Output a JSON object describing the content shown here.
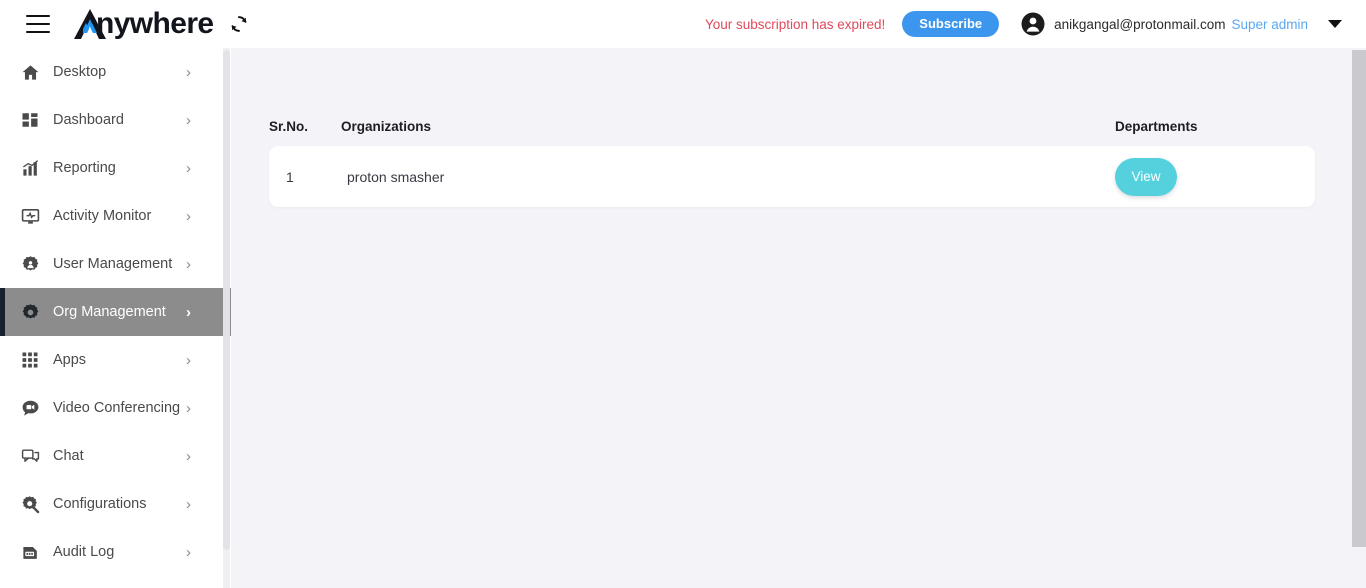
{
  "header": {
    "menu_icon": "hamburger-menu-icon",
    "brand_name": "nywhere",
    "brand_full": "Anywhere",
    "refresh_icon": "refresh-sync-icon",
    "subscription_notice": "Your subscription has expired!",
    "subscribe_label": "Subscribe",
    "avatar_icon": "user-avatar-icon",
    "user_email": "anikgangal@protonmail.com",
    "user_role": "Super admin",
    "dropdown_icon": "chevron-down-icon",
    "accent_blue": "#3d96ee",
    "role_blue": "#5aa8f0",
    "alert_red": "#e04a5b"
  },
  "sidebar": {
    "items": [
      {
        "label": "Desktop",
        "icon": "home-icon",
        "chevron": "›",
        "active": false
      },
      {
        "label": "Dashboard",
        "icon": "dashboard-grid-icon",
        "chevron": "›",
        "active": false
      },
      {
        "label": "Reporting",
        "icon": "bar-chart-icon",
        "chevron": "›",
        "active": false
      },
      {
        "label": "Activity Monitor",
        "icon": "monitor-activity-icon",
        "chevron": "›",
        "active": false
      },
      {
        "label": "User Management",
        "icon": "gear-user-icon",
        "chevron": "›",
        "active": false
      },
      {
        "label": "Org Management",
        "icon": "gear-icon",
        "chevron": "›",
        "active": true
      },
      {
        "label": "Apps",
        "icon": "apps-grid-icon",
        "chevron": "›",
        "active": false
      },
      {
        "label": "Video Conferencing",
        "icon": "video-chat-icon",
        "chevron": "›",
        "active": false
      },
      {
        "label": "Chat",
        "icon": "chat-bubble-icon",
        "chevron": "›",
        "active": false
      },
      {
        "label": "Configurations",
        "icon": "gear-wrench-icon",
        "chevron": "›",
        "active": false
      },
      {
        "label": "Audit Log",
        "icon": "audit-document-icon",
        "chevron": "›",
        "active": false
      }
    ],
    "active_background": "#8c8c8c",
    "active_border": "#17202c"
  },
  "main": {
    "table": {
      "columns": [
        {
          "key": "sr",
          "label": "Sr.No."
        },
        {
          "key": "org",
          "label": "Organizations"
        },
        {
          "key": "dep",
          "label": "Departments"
        }
      ],
      "rows": [
        {
          "sr": "1",
          "org": "proton smasher",
          "action_label": "View"
        }
      ]
    },
    "view_button_color": "#55d1de",
    "background": "#f4f4f8"
  }
}
